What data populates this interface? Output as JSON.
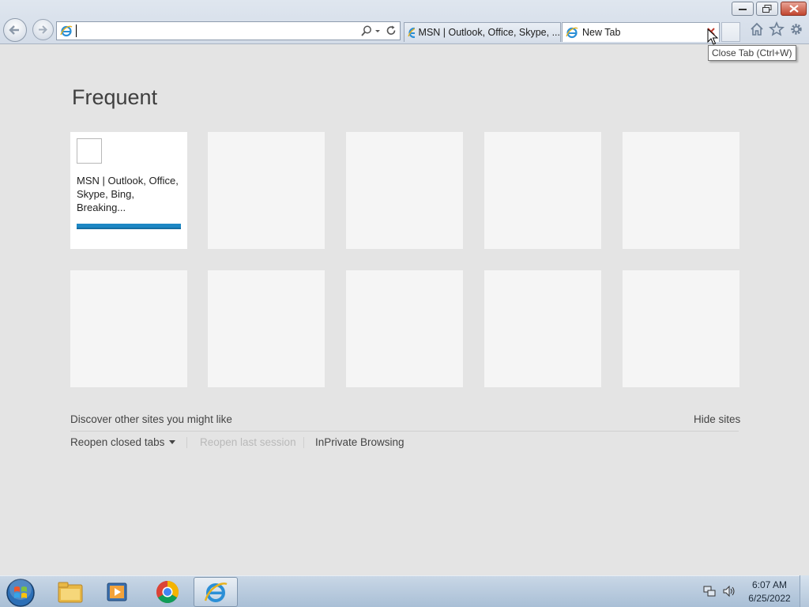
{
  "browser": {
    "address_value": "",
    "tabs": [
      {
        "label": "MSN | Outlook, Office, Skype, ...",
        "active": false
      },
      {
        "label": "New Tab",
        "active": true
      }
    ],
    "tooltip": "Close Tab (Ctrl+W)",
    "icons": [
      "back-icon",
      "forward-icon",
      "ie-icon",
      "search-icon",
      "refresh-icon",
      "home-icon",
      "star-icon",
      "gear-icon"
    ]
  },
  "newtab": {
    "heading": "Frequent",
    "tiles": [
      {
        "title": "MSN | Outlook, Office, Skype, Bing, Breaking...",
        "filled": true
      },
      {
        "title": "",
        "filled": false
      },
      {
        "title": "",
        "filled": false
      },
      {
        "title": "",
        "filled": false
      },
      {
        "title": "",
        "filled": false
      },
      {
        "title": "",
        "filled": false
      },
      {
        "title": "",
        "filled": false
      },
      {
        "title": "",
        "filled": false
      },
      {
        "title": "",
        "filled": false
      },
      {
        "title": "",
        "filled": false
      }
    ],
    "discover": "Discover other sites you might like",
    "hide_sites": "Hide sites",
    "reopen_closed": "Reopen closed tabs",
    "reopen_session": "Reopen last session",
    "inprivate": "InPrivate Browsing"
  },
  "taskbar": {
    "apps": [
      "file-explorer-icon",
      "media-player-icon",
      "chrome-icon",
      "internet-explorer-icon"
    ],
    "time": "6:07 AM",
    "date": "6/25/2022"
  },
  "colors": {
    "accent": "#1d87c4",
    "page_bg": "#e4e4e4",
    "tile_bg": "#f5f5f5"
  }
}
